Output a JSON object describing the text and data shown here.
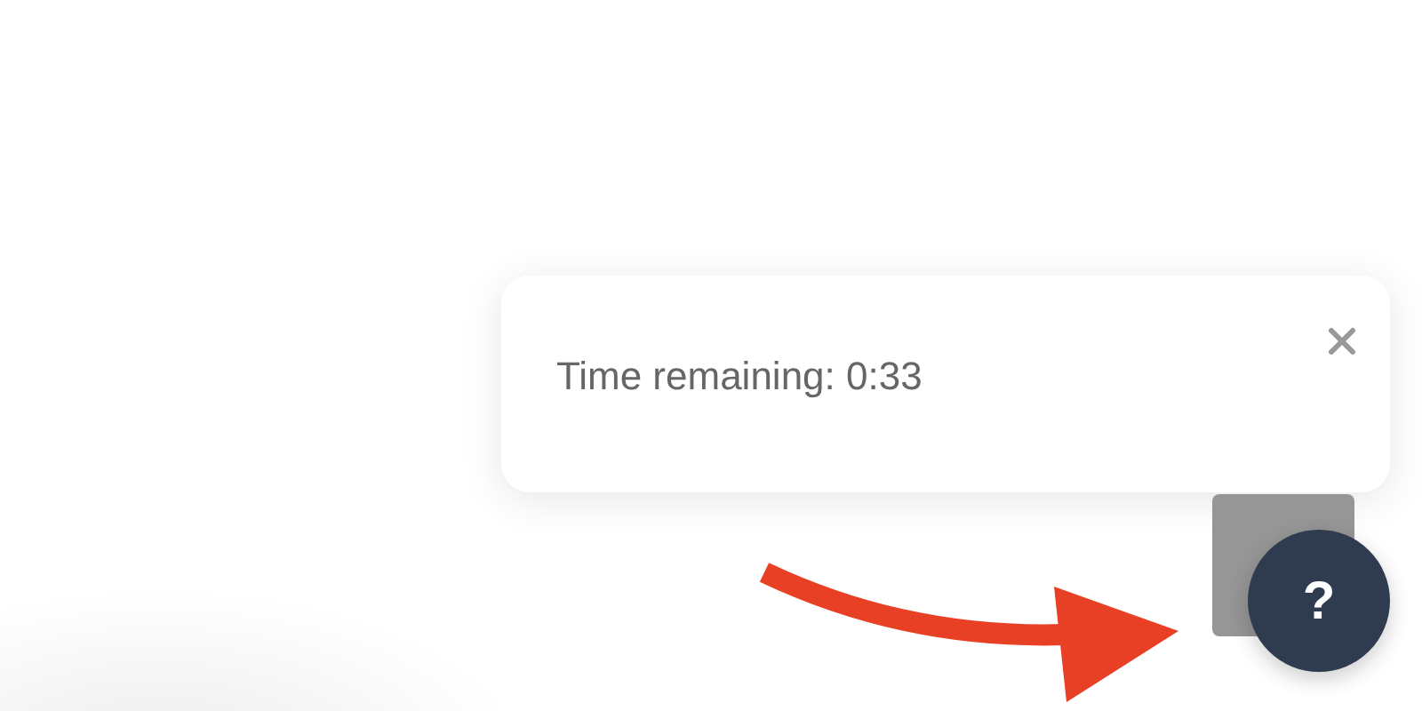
{
  "toast": {
    "message": "Time remaining: 0:33"
  },
  "help_button": {
    "label": "?"
  }
}
